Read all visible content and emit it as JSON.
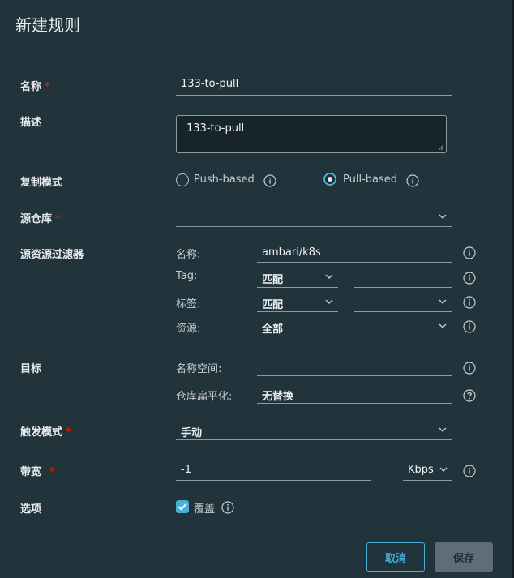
{
  "dialog": {
    "title": "新建规则"
  },
  "name": {
    "label": "名称",
    "required": "*",
    "value": "133-to-pull"
  },
  "description": {
    "label": "描述",
    "value": "133-to-pull"
  },
  "replication_mode": {
    "label": "复制模式",
    "options": [
      {
        "label": "Push-based",
        "selected": false
      },
      {
        "label": "Pull-based",
        "selected": true
      }
    ]
  },
  "source_registry": {
    "label": "源仓库",
    "required": "*",
    "value": ""
  },
  "source_filter": {
    "label": "源资源过滤器",
    "name_label": "名称:",
    "name_value": "ambari/k8s",
    "tag_label": "Tag:",
    "tag_match": "匹配",
    "tag_value": "",
    "labels_label": "标签:",
    "labels_match": "匹配",
    "labels_value": "",
    "resource_label": "资源:",
    "resource_value": "全部"
  },
  "destination": {
    "label": "目标",
    "namespace_label": "名称空间:",
    "namespace_value": "",
    "flattening_label": "仓库扁平化:",
    "flattening_value": "无替换"
  },
  "trigger_mode": {
    "label": "触发模式",
    "required": "*",
    "value": "手动"
  },
  "bandwidth": {
    "label": "带宽",
    "required": "*",
    "value": "-1",
    "unit": "Kbps"
  },
  "options": {
    "label": "选项",
    "override_label": "覆盖",
    "override_checked": true
  },
  "footer": {
    "cancel_label": "取消",
    "save_label": "保存"
  },
  "colors": {
    "background": "#21333b",
    "accent": "#49afd9",
    "required": "#c92100",
    "disabled_button": "#5f6e76"
  },
  "icons": [
    "info-icon",
    "chevron-down-icon",
    "resize-handle-icon",
    "checkmark-icon"
  ]
}
